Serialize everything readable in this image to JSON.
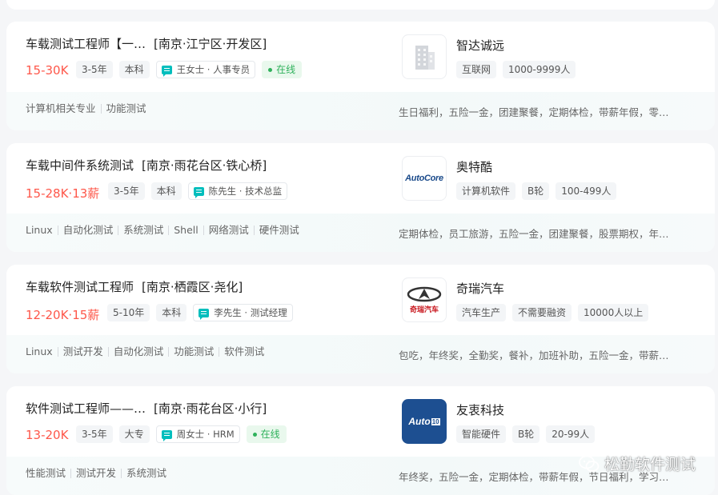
{
  "jobs": [
    {
      "title": "车载测试工程师【一…",
      "location": "[南京·江宁区·开发区]",
      "salary": "15-30K",
      "experience": "3-5年",
      "degree": "本科",
      "recruiter": "王女士 · 人事专员",
      "online": "在线",
      "company": "智达诚远",
      "logo_icon": "building-icon",
      "company_tags": [
        "互联网",
        "1000-9999人"
      ],
      "skills": [
        "计算机相关专业",
        "功能测试"
      ],
      "benefits": "生日福利，五险一金，团建聚餐，定期体检，带薪年假，零…"
    },
    {
      "title": "车载中间件系统测试",
      "location": "[南京·雨花台区·铁心桥]",
      "salary": "15-28K·13薪",
      "experience": "3-5年",
      "degree": "本科",
      "recruiter": "陈先生 · 技术总监",
      "online": "",
      "company": "奥特酷",
      "logo_text": "AutoCore",
      "company_tags": [
        "计算机软件",
        "B轮",
        "100-499人"
      ],
      "skills": [
        "Linux",
        "自动化测试",
        "系统测试",
        "Shell",
        "网络测试",
        "硬件测试"
      ],
      "benefits": "定期体检，员工旅游，五险一金，团建聚餐，股票期权，年…"
    },
    {
      "title": "车载软件测试工程师",
      "location": "[南京·栖霞区·尧化]",
      "salary": "12-20K·15薪",
      "experience": "5-10年",
      "degree": "本科",
      "recruiter": "李先生 · 测试经理",
      "online": "",
      "company": "奇瑞汽车",
      "logo_text": "奇瑞汽车",
      "company_tags": [
        "汽车生产",
        "不需要融资",
        "10000人以上"
      ],
      "skills": [
        "Linux",
        "测试开发",
        "自动化测试",
        "功能测试",
        "软件测试"
      ],
      "benefits": "包吃，年终奖，全勤奖，餐补，加班补助，五险一金，带薪…"
    },
    {
      "title": "软件测试工程师——…",
      "location": "[南京·雨花台区·小行]",
      "salary": "13-20K",
      "experience": "3-5年",
      "degree": "大专",
      "recruiter": "周女士 · HRM",
      "online": "在线",
      "company": "友衷科技",
      "logo_text": "Auto",
      "logo_text_box": "10",
      "company_tags": [
        "智能硬件",
        "B轮",
        "20-99人"
      ],
      "skills": [
        "性能测试",
        "测试开发",
        "系统测试"
      ],
      "benefits": "年终奖，五险一金，定期体检，带薪年假，节日福利，学习…"
    }
  ],
  "watermark": "松勤软件测试",
  "colors": {
    "salary": "#fe574a",
    "online": "#2fb15b",
    "chat_icon": "#00bebd"
  }
}
